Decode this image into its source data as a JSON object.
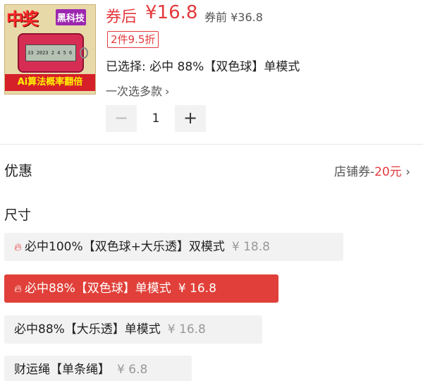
{
  "product": {
    "image": {
      "badge_win": "中奖",
      "badge_tech": "黑科技",
      "screen_text": "33 2023 2 4 5 6",
      "banner": "Ai算法概率翻倍"
    },
    "price_label": "券后",
    "price_value": "¥16.8",
    "before_price": "券前 ¥36.8",
    "promo_tag": "2件9.5折",
    "selected_text": "已选择: 必中 88%【双色球】单模式",
    "multi_select": "一次选多款",
    "quantity": "1",
    "minus_label": "−",
    "plus_label": "+"
  },
  "discount": {
    "title": "优惠",
    "coupon_label": "店铺券-",
    "coupon_amount": "20元",
    "chevron": "›"
  },
  "size": {
    "title": "尺寸",
    "options": [
      {
        "label": "必中100%【双色球+大乐透】双模式",
        "price": "¥ 18.8",
        "hot": true,
        "selected": false
      },
      {
        "label": "必中88%【双色球】单模式",
        "price": "¥ 16.8",
        "hot": true,
        "selected": true
      },
      {
        "label": "必中88%【大乐透】单模式",
        "price": "¥ 16.8",
        "hot": false,
        "selected": false
      },
      {
        "label": "财运绳【单条绳】",
        "price": "¥ 6.8",
        "hot": false,
        "selected": false
      }
    ]
  },
  "colors": {
    "accent": "#e4393c",
    "selected_bg": "#e04039",
    "option_bg": "#f2f2f2"
  },
  "icons": {
    "flame": "flame-icon",
    "chevron": "chevron-right-icon"
  }
}
